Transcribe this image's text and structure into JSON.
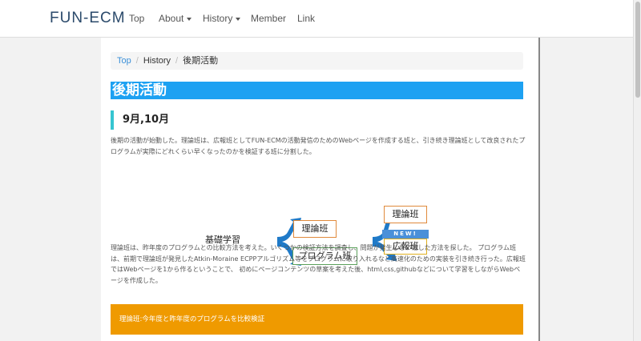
{
  "nav": {
    "brand": "FUN-ECM",
    "items": [
      {
        "label": "Top"
      },
      {
        "label": "About"
      },
      {
        "label": "History"
      },
      {
        "label": "Member"
      },
      {
        "label": "Link"
      }
    ]
  },
  "breadcrumb": {
    "top": "Top",
    "history": "History",
    "current": "後期活動"
  },
  "page": {
    "title": "後期活動",
    "section_heading": "9月,10月",
    "intro": "後期の活動が始動した。理論班は、広報班としてFUN-ECMの活動発信のためのWebページを作成する班と、引き続き理論班として改良されたプログラムが実際にどれくらい早くなったのかを検証する班に分割した。",
    "body": "理論班は、昨年度のプログラムとの比較方法を考えた。いくつかの検証方法を調査し、問題が発生しない適した方法を探した。 プログラム班は、前期で理論班が発見したAtkin-Moraine ECPPアルゴリズム等をプログラムに取り入れるなど高速化のための実装を引き続き行った。広報班ではWebページを1から作るということで、 初めにページコンテンツの草案を考えた後、html,css,githubなどについて学習をしながらWebページを作成した。",
    "orange_bar": "理論班:今年度と昨年度のプログラムを比較検証"
  },
  "diagram": {
    "base": "基礎学習",
    "theory": "理論班",
    "program": "プログラム班",
    "theory2": "理論班",
    "new_badge": "NEW!",
    "pr": "広報班"
  },
  "colors": {
    "title_bar": "#1da1f2",
    "section_accent": "#36c5d1",
    "arrow": "#1f7ac8",
    "orange": "#ef9a00",
    "box_orange": "#e08a3c",
    "box_green": "#5aa05a",
    "box_yellow": "#e0b020"
  }
}
